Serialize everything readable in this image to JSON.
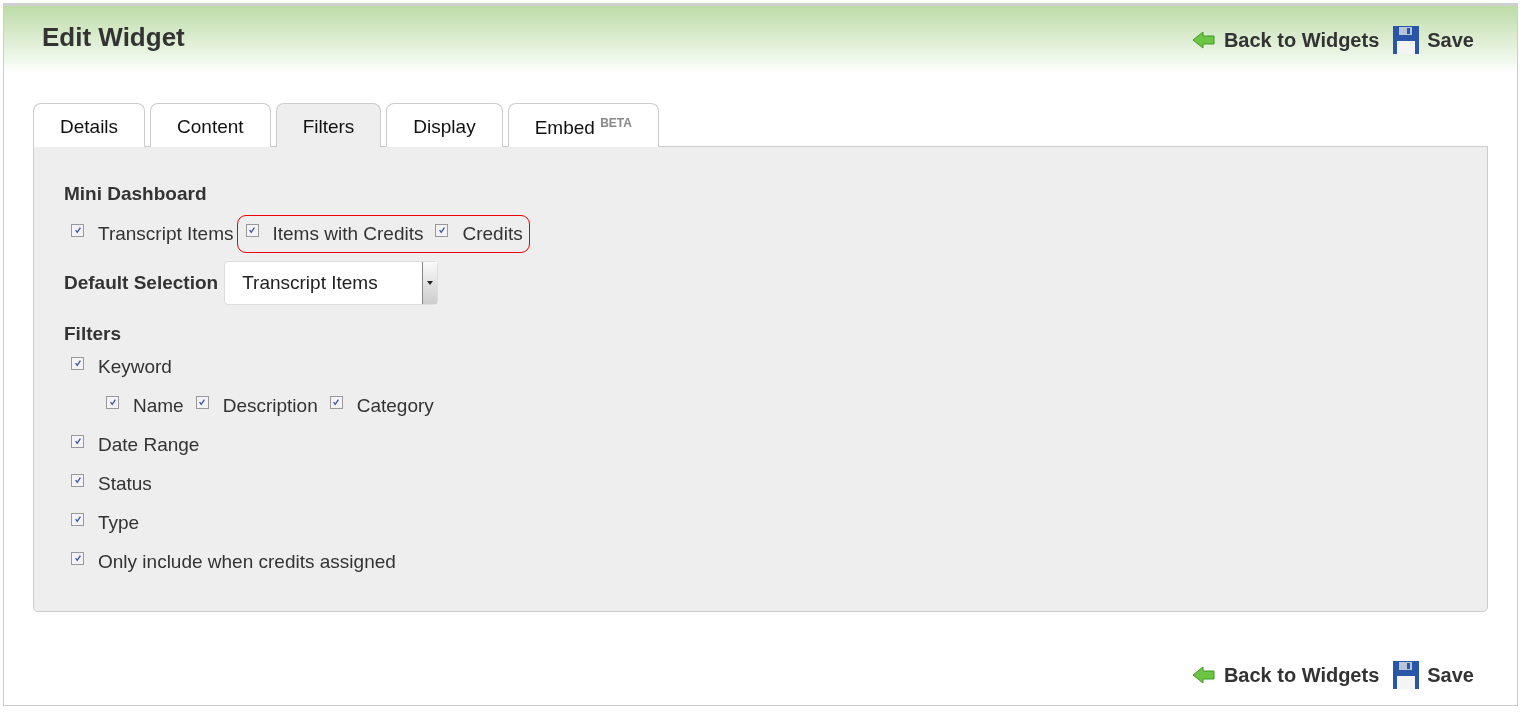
{
  "header": {
    "title": "Edit Widget",
    "actions": [
      {
        "kind": "back",
        "label": "Back to Widgets"
      },
      {
        "kind": "save",
        "label": "Save"
      }
    ]
  },
  "tabs": [
    {
      "label": "Details",
      "selected": false
    },
    {
      "label": "Content",
      "selected": false
    },
    {
      "label": "Filters",
      "selected": true
    },
    {
      "label": "Display",
      "selected": false
    },
    {
      "label": "Embed $^{BETA}$",
      "selected": false
    }
  ],
  "mini_dashboard": {
    "heading": "Mini Dashboard",
    "options": [
      {
        "label": "Transcript Items",
        "checked": true,
        "highlighted": false
      },
      {
        "label": "Items with Credits",
        "checked": true,
        "highlighted": true
      },
      {
        "label": "Credits",
        "checked": true,
        "highlighted": true
      }
    ]
  },
  "default_selection": {
    "label": "Default Selection",
    "value": "Transcript Items"
  },
  "filters": {
    "heading": "Filters",
    "items": [
      {
        "label": "Keyword",
        "checked": true,
        "children": [
          {
            "label": "Name",
            "checked": true
          },
          {
            "label": "Description",
            "checked": true
          },
          {
            "label": "Category",
            "checked": true
          }
        ]
      },
      {
        "label": "Date Range",
        "checked": true
      },
      {
        "label": "Status",
        "checked": true
      },
      {
        "label": "Type",
        "checked": true
      },
      {
        "label": "Only include when credits assigned",
        "checked": true
      }
    ]
  },
  "footer": {
    "actions": [
      {
        "kind": "back",
        "label": "Back to Widgets"
      },
      {
        "kind": "save",
        "label": "Save"
      }
    ]
  }
}
